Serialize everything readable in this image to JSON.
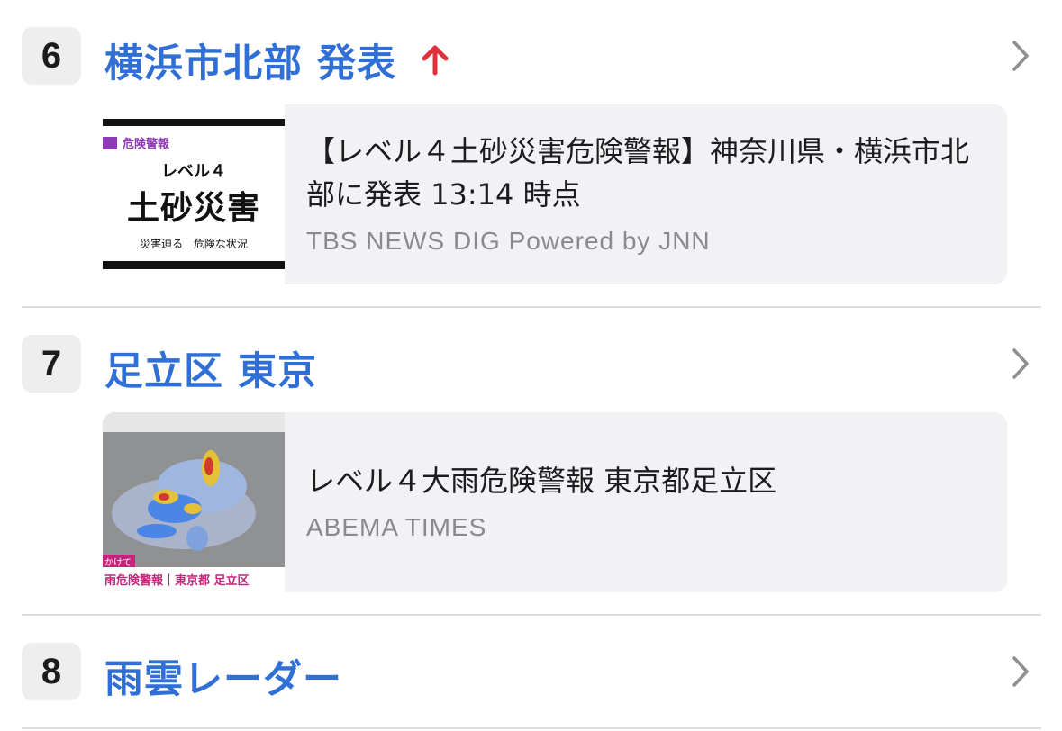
{
  "items": [
    {
      "rank": "6",
      "title": "横浜市北部 発表",
      "trend": "up-arrow",
      "article": {
        "headline": "【レベル４土砂災害危険警報】神奈川県・横浜市北部に発表 13:14 時点",
        "source": "TBS NEWS DIG Powered by JNN"
      },
      "thumbnail": {
        "tag_label": "危険警報",
        "level": "レベル４",
        "main": "土砂災害",
        "caption": "災害迫る 危険な状況"
      }
    },
    {
      "rank": "7",
      "title": "足立区 東京",
      "article": {
        "headline": "レベル４大雨危険警報 東京都足立区",
        "source": "ABEMA TIMES"
      },
      "thumbnail": {
        "tag_label": "かけて",
        "caption": "雨危険警報｜東京都 足立区"
      }
    },
    {
      "rank": "8",
      "title": "雨雲レーダー"
    }
  ],
  "colors": {
    "title_blue": "#2f6fd6",
    "trend_red": "#e0313a",
    "card_bg": "#f2f2f4",
    "badge_bg": "#eeeeef"
  },
  "icons": {
    "chevron": "chevron-right-icon",
    "trend": "up-arrow-icon"
  }
}
